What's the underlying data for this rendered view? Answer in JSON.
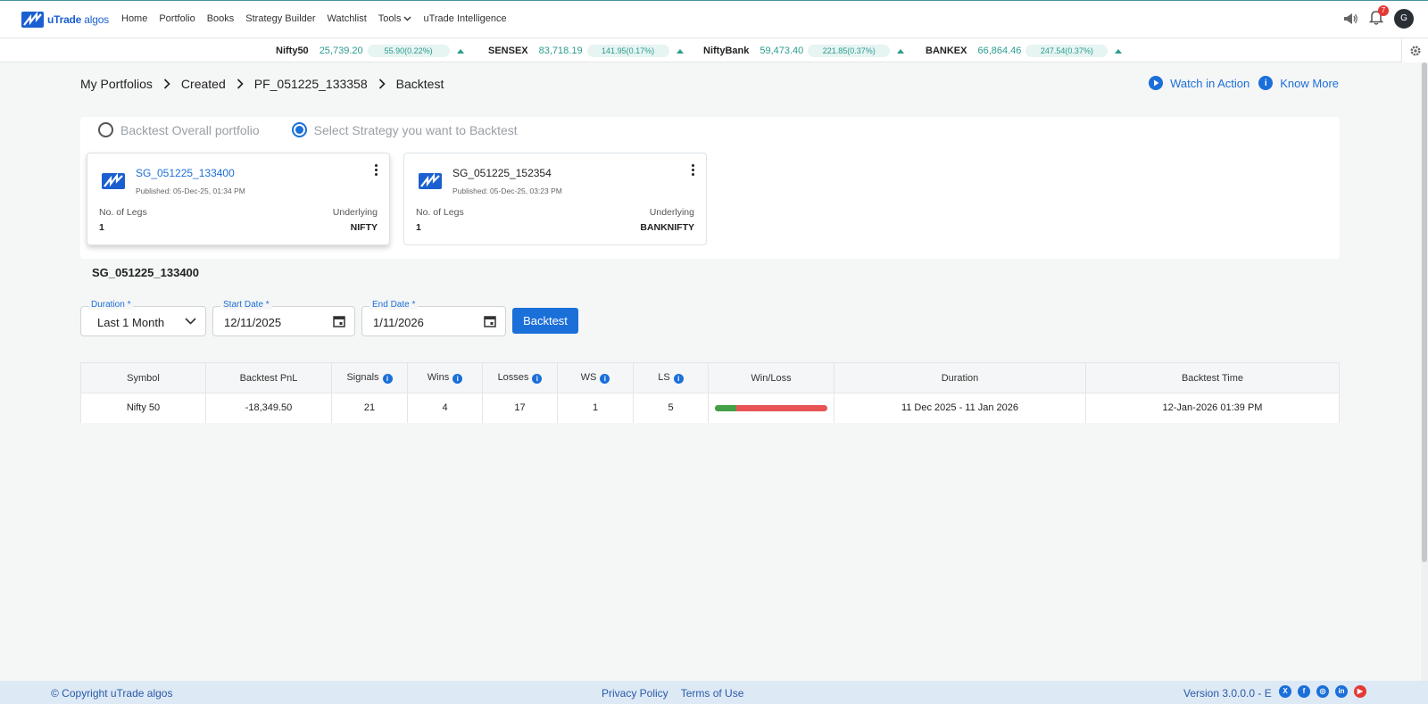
{
  "brand": {
    "name_bold": "uTrade",
    "name_light": "algos"
  },
  "nav": {
    "items": [
      "Home",
      "Portfolio",
      "Books",
      "Strategy Builder",
      "Watchlist",
      "Tools",
      "uTrade Intelligence"
    ],
    "notifications_count": "7",
    "avatar_initial": "G"
  },
  "ticker": [
    {
      "name": "Nifty50",
      "value": "25,739.20",
      "change": "55.90(0.22%)"
    },
    {
      "name": "SENSEX",
      "value": "83,718.19",
      "change": "141.95(0.17%)"
    },
    {
      "name": "NiftyBank",
      "value": "59,473.40",
      "change": "221.85(0.37%)"
    },
    {
      "name": "BANKEX",
      "value": "66,864.46",
      "change": "247.54(0.37%)"
    }
  ],
  "breadcrumb": [
    "My Portfolios",
    "Created",
    "PF_051225_133358",
    "Backtest"
  ],
  "actions": {
    "watch": "Watch in Action",
    "know": "Know More"
  },
  "radios": {
    "overall": "Backtest Overall portfolio",
    "select": "Select Strategy you want to Backtest",
    "selected": "select"
  },
  "strategies": [
    {
      "name": "SG_051225_133400",
      "published": "Published: 05-Dec-25, 01:34 PM",
      "legs_label": "No. of Legs",
      "legs": "1",
      "underlying_label": "Underlying",
      "underlying": "NIFTY",
      "selected": true
    },
    {
      "name": "SG_051225_152354",
      "published": "Published: 05-Dec-25, 03:23 PM",
      "legs_label": "No. of Legs",
      "legs": "1",
      "underlying_label": "Underlying",
      "underlying": "BANKNIFTY",
      "selected": false
    }
  ],
  "selected_strategy": "SG_051225_133400",
  "form": {
    "duration_label": "Duration *",
    "duration_value": "Last 1 Month",
    "start_label": "Start Date *",
    "start_value": "12/11/2025",
    "end_label": "End Date *",
    "end_value": "1/11/2026",
    "button": "Backtest"
  },
  "table": {
    "headers": [
      "Symbol",
      "Backtest PnL",
      "Signals",
      "Wins",
      "Losses",
      "WS",
      "LS",
      "Win/Loss",
      "Duration",
      "Backtest Time"
    ],
    "rows": [
      {
        "symbol": "Nifty 50",
        "pnl": "-18,349.50",
        "signals": "21",
        "wins": "4",
        "losses": "17",
        "ws": "1",
        "ls": "5",
        "win_fraction": 0.19,
        "duration": "11 Dec 2025 - 11 Jan 2026",
        "time": "12-Jan-2026 01:39 PM"
      }
    ]
  },
  "footer": {
    "copyright": "© Copyright uTrade algos",
    "privacy": "Privacy Policy",
    "terms": "Terms of Use",
    "version": "Version 3.0.0.0 - E"
  },
  "colors": {
    "accent": "#1b6fd9",
    "positive": "#43a047",
    "negative": "#e05252",
    "ticker": "#2a9d8f"
  }
}
